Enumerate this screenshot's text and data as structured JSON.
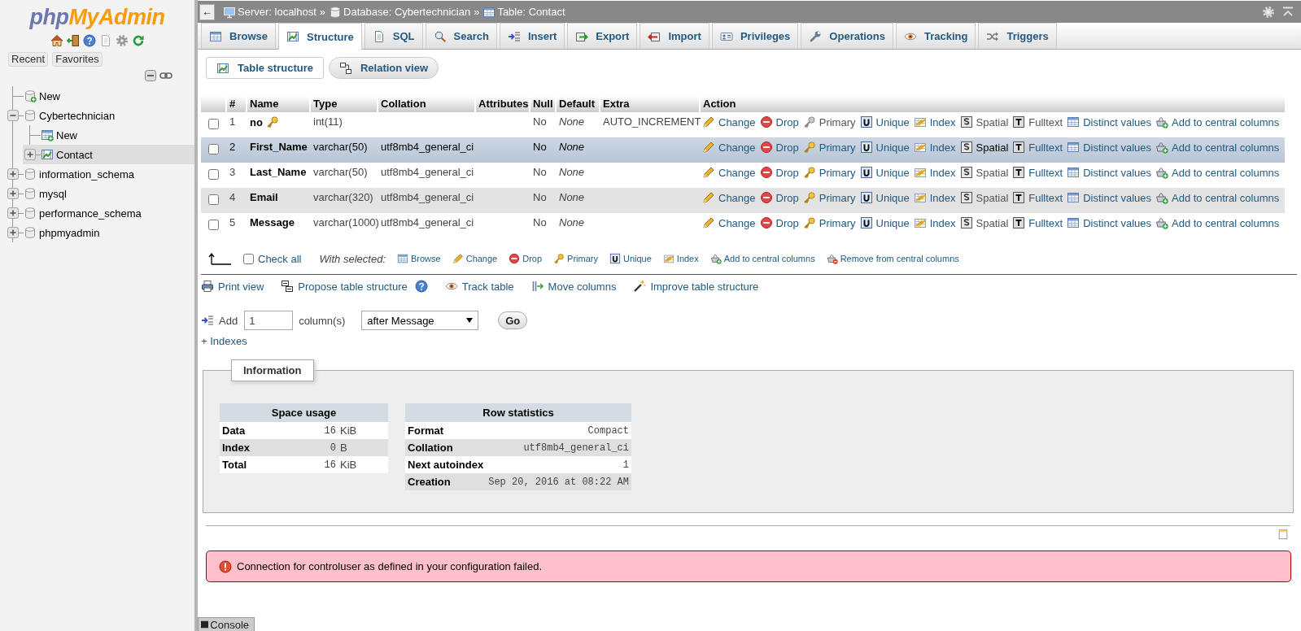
{
  "sidebar": {
    "logo": [
      {
        "text": "php",
        "color": "#6c78af"
      },
      {
        "text": "MyAdmin",
        "color": "#f89c0e"
      }
    ],
    "buttons": [
      "Recent",
      "Favorites"
    ],
    "tree": [
      {
        "label": "New",
        "kind": "new_database",
        "selected": false
      },
      {
        "label": "Cybertechnician",
        "kind": "database",
        "expanded": true,
        "selected": false,
        "children": [
          {
            "label": "New",
            "kind": "new_table",
            "selected": false
          },
          {
            "label": "Contact",
            "kind": "table",
            "expanded": false,
            "selected": true
          }
        ]
      },
      {
        "label": "information_schema",
        "kind": "database",
        "expanded": false,
        "selected": false
      },
      {
        "label": "mysql",
        "kind": "database",
        "expanded": false,
        "selected": false
      },
      {
        "label": "performance_schema",
        "kind": "database",
        "expanded": false,
        "selected": false
      },
      {
        "label": "phpmyadmin",
        "kind": "database",
        "expanded": false,
        "selected": false
      }
    ]
  },
  "breadcrumb": {
    "back": "←",
    "items": [
      {
        "kind": "server",
        "label": "Server: localhost",
        "separator": "»"
      },
      {
        "kind": "database",
        "label": "Database: Cybertechnician",
        "separator": "»"
      },
      {
        "kind": "table",
        "label": "Table: Contact"
      }
    ]
  },
  "tabs": [
    {
      "kind": "browse",
      "label": "Browse",
      "selected": false
    },
    {
      "kind": "structure",
      "label": "Structure",
      "selected": true
    },
    {
      "kind": "sql",
      "label": "SQL",
      "selected": false
    },
    {
      "kind": "search",
      "label": "Search",
      "selected": false
    },
    {
      "kind": "insert",
      "label": "Insert",
      "selected": false
    },
    {
      "kind": "export",
      "label": "Export",
      "selected": false
    },
    {
      "kind": "import",
      "label": "Import",
      "selected": false
    },
    {
      "kind": "privileges",
      "label": "Privileges",
      "selected": false
    },
    {
      "kind": "operations",
      "label": "Operations",
      "selected": false
    },
    {
      "kind": "tracking",
      "label": "Tracking",
      "selected": false
    },
    {
      "kind": "triggers",
      "label": "Triggers",
      "selected": false
    }
  ],
  "subtabs": [
    {
      "kind": "structure",
      "label": "Table structure",
      "selected": true
    },
    {
      "kind": "relation",
      "label": "Relation view",
      "selected": false
    }
  ],
  "table": {
    "columns": [
      "#",
      "Name",
      "Type",
      "Collation",
      "Attributes",
      "Null",
      "Default",
      "Extra",
      "Action"
    ],
    "rows": [
      {
        "checked": false,
        "hovered": false,
        "number": "1",
        "name": "no",
        "primary_key": true,
        "type": "int(11)",
        "null": "No",
        "default": "None",
        "extra": "AUTO_INCREMENT",
        "actions": [
          {
            "kind": "change",
            "label": "Change",
            "disabled": false
          },
          {
            "kind": "drop",
            "label": "Drop",
            "disabled": false
          },
          {
            "kind": "primary",
            "label": "Primary",
            "disabled": true
          },
          {
            "kind": "unique",
            "label": "Unique",
            "disabled": false
          },
          {
            "kind": "index",
            "label": "Index",
            "disabled": false
          },
          {
            "kind": "spatial",
            "label": "Spatial",
            "disabled": true
          },
          {
            "kind": "fulltext",
            "label": "Fulltext",
            "disabled": true
          },
          {
            "kind": "distinct",
            "label": "Distinct values",
            "disabled": false
          },
          {
            "kind": "central",
            "label": "Add to central columns",
            "disabled": false
          }
        ]
      },
      {
        "checked": false,
        "hovered": true,
        "number": "2",
        "name": "First_Name",
        "primary_key": false,
        "type": "varchar(50)",
        "collation": "utf8mb4_general_ci",
        "null": "No",
        "default": "None",
        "actions": [
          {
            "kind": "change",
            "label": "Change",
            "disabled": false
          },
          {
            "kind": "drop",
            "label": "Drop",
            "disabled": false
          },
          {
            "kind": "primary",
            "label": "Primary",
            "disabled": false
          },
          {
            "kind": "unique",
            "label": "Unique",
            "disabled": false
          },
          {
            "kind": "index",
            "label": "Index",
            "disabled": false
          },
          {
            "kind": "spatial",
            "label": "Spatial",
            "disabled": true
          },
          {
            "kind": "fulltext",
            "label": "Fulltext",
            "disabled": false
          },
          {
            "kind": "distinct",
            "label": "Distinct values",
            "disabled": false
          },
          {
            "kind": "central",
            "label": "Add to central columns",
            "disabled": false
          }
        ]
      },
      {
        "checked": false,
        "hovered": false,
        "number": "3",
        "name": "Last_Name",
        "primary_key": false,
        "type": "varchar(50)",
        "collation": "utf8mb4_general_ci",
        "null": "No",
        "default": "None",
        "actions": [
          {
            "kind": "change",
            "label": "Change",
            "disabled": false
          },
          {
            "kind": "drop",
            "label": "Drop",
            "disabled": false
          },
          {
            "kind": "primary",
            "label": "Primary",
            "disabled": false
          },
          {
            "kind": "unique",
            "label": "Unique",
            "disabled": false
          },
          {
            "kind": "index",
            "label": "Index",
            "disabled": false
          },
          {
            "kind": "spatial",
            "label": "Spatial",
            "disabled": true
          },
          {
            "kind": "fulltext",
            "label": "Fulltext",
            "disabled": false
          },
          {
            "kind": "distinct",
            "label": "Distinct values",
            "disabled": false
          },
          {
            "kind": "central",
            "label": "Add to central columns",
            "disabled": false
          }
        ]
      },
      {
        "checked": false,
        "hovered": false,
        "number": "4",
        "name": "Email",
        "primary_key": false,
        "type": "varchar(320)",
        "collation": "utf8mb4_general_ci",
        "null": "No",
        "default": "None",
        "actions": [
          {
            "kind": "change",
            "label": "Change",
            "disabled": false
          },
          {
            "kind": "drop",
            "label": "Drop",
            "disabled": false
          },
          {
            "kind": "primary",
            "label": "Primary",
            "disabled": false
          },
          {
            "kind": "unique",
            "label": "Unique",
            "disabled": false
          },
          {
            "kind": "index",
            "label": "Index",
            "disabled": false
          },
          {
            "kind": "spatial",
            "label": "Spatial",
            "disabled": true
          },
          {
            "kind": "fulltext",
            "label": "Fulltext",
            "disabled": false
          },
          {
            "kind": "distinct",
            "label": "Distinct values",
            "disabled": false
          },
          {
            "kind": "central",
            "label": "Add to central columns",
            "disabled": false
          }
        ]
      },
      {
        "checked": false,
        "hovered": false,
        "number": "5",
        "name": "Message",
        "primary_key": false,
        "type": "varchar(1000)",
        "collation": "utf8mb4_general_ci",
        "null": "No",
        "default": "None",
        "actions": [
          {
            "kind": "change",
            "label": "Change",
            "disabled": false
          },
          {
            "kind": "drop",
            "label": "Drop",
            "disabled": false
          },
          {
            "kind": "primary",
            "label": "Primary",
            "disabled": false
          },
          {
            "kind": "unique",
            "label": "Unique",
            "disabled": false
          },
          {
            "kind": "index",
            "label": "Index",
            "disabled": false
          },
          {
            "kind": "spatial",
            "label": "Spatial",
            "disabled": true
          },
          {
            "kind": "fulltext",
            "label": "Fulltext",
            "disabled": false
          },
          {
            "kind": "distinct",
            "label": "Distinct values",
            "disabled": false
          },
          {
            "kind": "central",
            "label": "Add to central columns",
            "disabled": false
          }
        ]
      }
    ]
  },
  "bulk_actions": {
    "check_all": {
      "label": "Check all",
      "checked": false
    },
    "with_selected": "With selected:",
    "buttons": [
      {
        "kind": "browse",
        "label": "Browse"
      },
      {
        "kind": "change",
        "label": "Change"
      },
      {
        "kind": "drop",
        "label": "Drop"
      },
      {
        "kind": "primary",
        "label": "Primary"
      },
      {
        "kind": "unique",
        "label": "Unique"
      },
      {
        "kind": "index",
        "label": "Index"
      },
      {
        "kind": "central",
        "label": "Add to central columns"
      },
      {
        "kind": "remove_central",
        "label": "Remove from central columns"
      }
    ]
  },
  "links": [
    {
      "kind": "print",
      "label": "Print view"
    },
    {
      "kind": "propose",
      "label": "Propose table structure"
    },
    {
      "kind": "track",
      "label": "Track table"
    },
    {
      "kind": "move",
      "label": "Move columns"
    },
    {
      "kind": "improve",
      "label": "Improve table structure"
    }
  ],
  "add_columns": {
    "label": "Add",
    "count": "1",
    "unit": "column(s)",
    "position": "after Message",
    "button": "Go"
  },
  "indexes_toggle": "+ Indexes",
  "information": {
    "title": "Information",
    "space_usage": {
      "title": "Space usage",
      "rows": [
        {
          "label": "Data",
          "value": "16",
          "unit": "KiB"
        },
        {
          "label": "Index",
          "value": "0",
          "unit": "B"
        },
        {
          "label": "Total",
          "value": "16",
          "unit": "KiB"
        }
      ]
    },
    "row_statistics": {
      "title": "Row statistics",
      "rows": [
        {
          "label": "Format",
          "value": "Compact"
        },
        {
          "label": "Collation",
          "value": "utf8mb4_general_ci"
        },
        {
          "label": "Next autoindex",
          "value": "1"
        },
        {
          "label": "Creation",
          "value": "Sep 20, 2016 at 08:22 AM"
        }
      ]
    }
  },
  "error": "Connection for controluser as defined in your configuration failed.",
  "console": "Console"
}
